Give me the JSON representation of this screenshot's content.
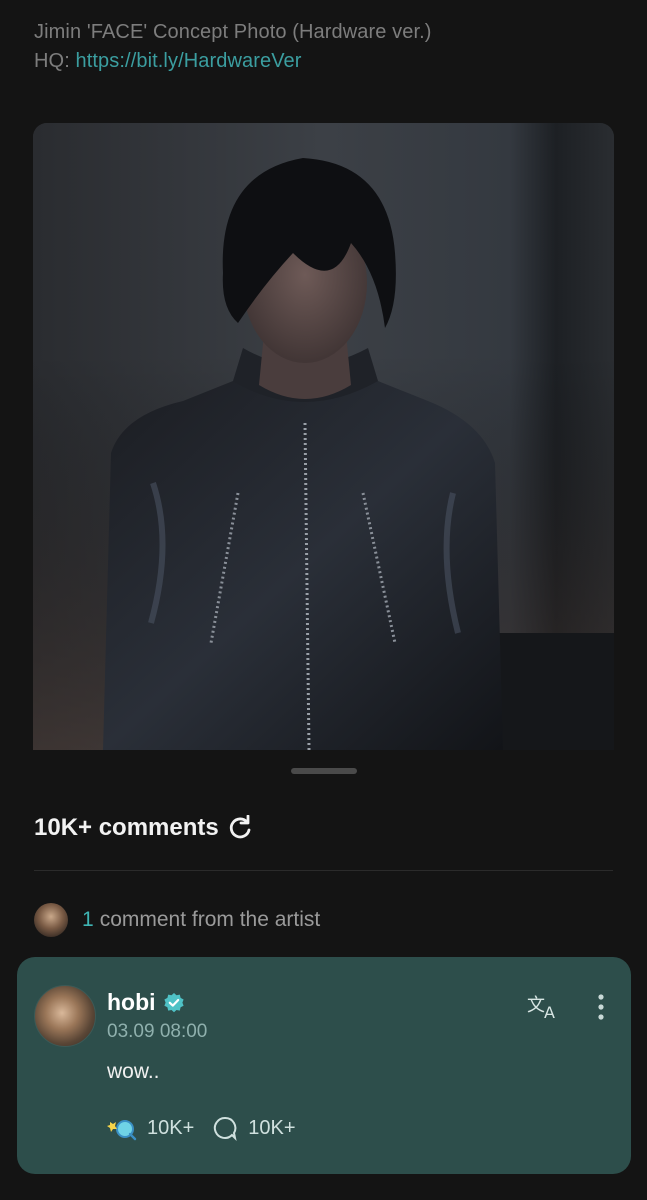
{
  "post": {
    "caption": "Jimin 'FACE' Concept Photo (Hardware ver.)",
    "hq_prefix": "HQ: ",
    "hq_link": "https://bit.ly/HardwareVer"
  },
  "comments_section": {
    "title": "10K+ comments",
    "artist_count": "1",
    "artist_label": "comment from the artist"
  },
  "comment": {
    "username": "hobi",
    "timestamp": "03.09 08:00",
    "text": "wow..",
    "likes": "10K+",
    "replies": "10K+"
  },
  "colors": {
    "background": "#141414",
    "card": "#2d4e4b",
    "accent": "#3fb5b4",
    "link": "#3b9ea0"
  },
  "icons": [
    "refresh-icon",
    "verified-icon",
    "translate-icon",
    "more-icon",
    "reaction-icon",
    "reply-icon"
  ]
}
